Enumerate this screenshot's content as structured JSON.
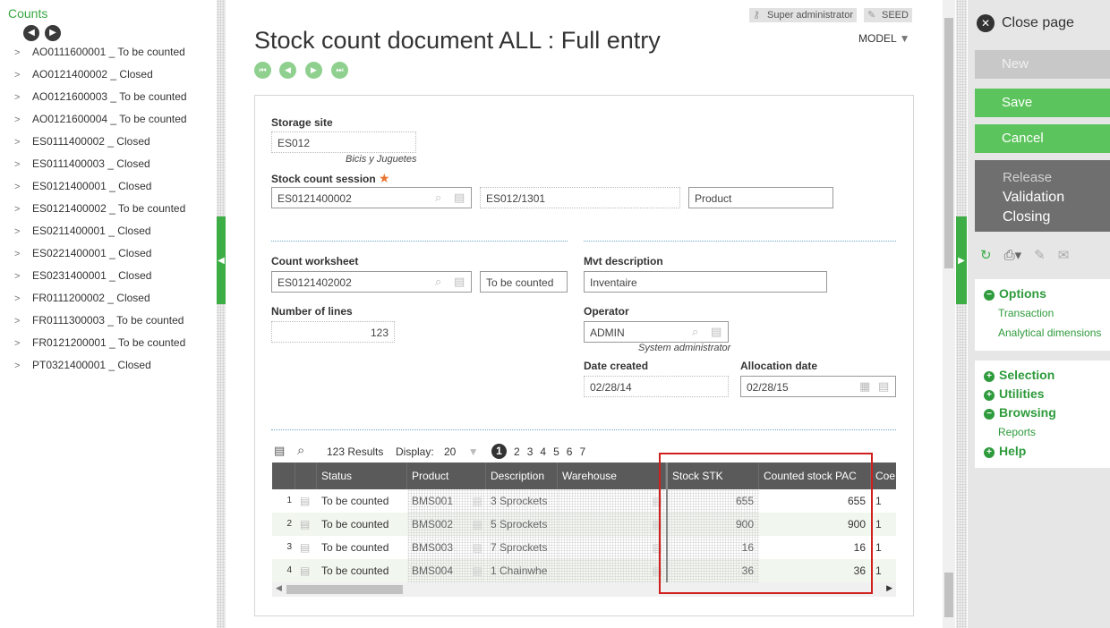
{
  "left": {
    "title": "Counts",
    "items": [
      "AO0111600001 _ To be counted",
      "AO0121400002 _ Closed",
      "AO0121600003 _ To be counted",
      "AO0121600004 _ To be counted",
      "ES0111400002 _ Closed",
      "ES0111400003 _ Closed",
      "ES0121400001 _ Closed",
      "ES0121400002 _ To be counted",
      "ES0211400001 _ Closed",
      "ES0221400001 _ Closed",
      "ES0231400001 _ Closed",
      "FR0111200002 _ Closed",
      "FR0111300003 _ To be counted",
      "FR0121200001 _ To be counted",
      "PT0321400001 _ Closed"
    ]
  },
  "header": {
    "user_badge": "Super administrator",
    "folder_badge": "SEED",
    "title": "Stock count document ALL : Full entry",
    "model": "MODEL"
  },
  "form": {
    "storage_site_label": "Storage site",
    "storage_site_value": "ES012",
    "storage_site_hint": "Bicis y Juguetes",
    "session_label": "Stock count session",
    "session_value": "ES0121400002",
    "session_ref": "ES012/1301",
    "session_type": "Product",
    "worksheet_label": "Count worksheet",
    "worksheet_value": "ES0121402002",
    "worksheet_status": "To be counted",
    "mvt_label": "Mvt description",
    "mvt_value": "Inventaire",
    "lines_label": "Number of lines",
    "lines_value": "123",
    "operator_label": "Operator",
    "operator_value": "ADMIN",
    "operator_hint": "System administrator",
    "date_created_label": "Date created",
    "date_created_value": "02/28/14",
    "allocation_label": "Allocation date",
    "allocation_value": "02/28/15"
  },
  "table": {
    "results": "123 Results",
    "display_label": "Display:",
    "display_value": "20",
    "pages": [
      "1",
      "2",
      "3",
      "4",
      "5",
      "6",
      "7"
    ],
    "columns": [
      "Status",
      "Product",
      "Description",
      "Warehouse",
      "Stock STK",
      "Counted stock PAC",
      "Coe"
    ],
    "rows": [
      {
        "n": "1",
        "status": "To be counted",
        "product": "BMS001",
        "desc": "3 Sprockets",
        "stock": "655",
        "counted": "655",
        "coe": "1"
      },
      {
        "n": "2",
        "status": "To be counted",
        "product": "BMS002",
        "desc": "5 Sprockets",
        "stock": "900",
        "counted": "900",
        "coe": "1"
      },
      {
        "n": "3",
        "status": "To be counted",
        "product": "BMS003",
        "desc": "7 Sprockets",
        "stock": "16",
        "counted": "16",
        "coe": "1"
      },
      {
        "n": "4",
        "status": "To be counted",
        "product": "BMS004",
        "desc": "1 Chainwhe",
        "stock": "36",
        "counted": "36",
        "coe": "1"
      }
    ]
  },
  "right": {
    "close_label": "Close page",
    "new_label": "New",
    "save_label": "Save",
    "cancel_label": "Cancel",
    "release_label": "Release",
    "validation_label": "Validation",
    "closing_label": "Closing",
    "options_label": "Options",
    "transaction_label": "Transaction",
    "analytical_label": "Analytical dimensions",
    "selection_label": "Selection",
    "utilities_label": "Utilities",
    "browsing_label": "Browsing",
    "reports_label": "Reports",
    "help_label": "Help"
  },
  "colors": {
    "accent": "#3cae45",
    "dark": "#5a5a5a",
    "highlight": "#d0201d"
  }
}
